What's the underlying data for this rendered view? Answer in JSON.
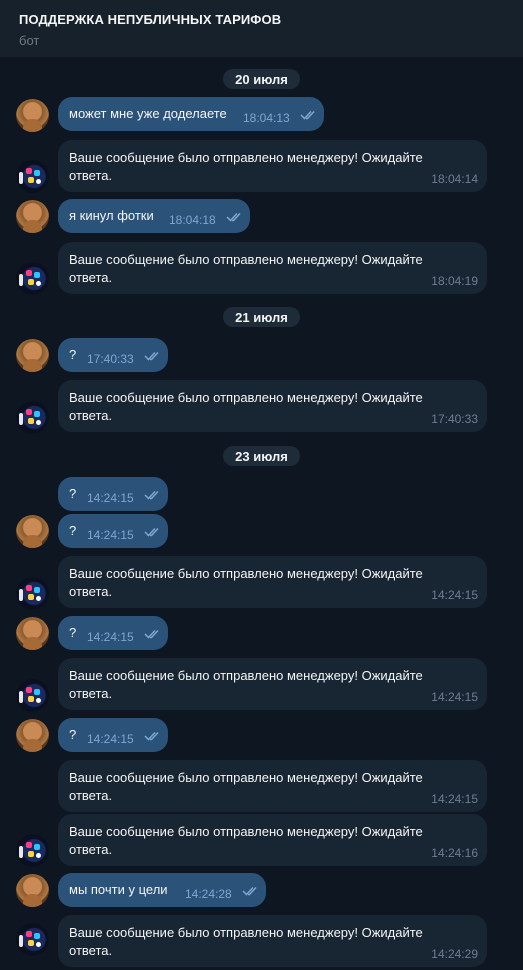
{
  "header": {
    "title": "ПОДДЕРЖКА НЕПУБЛИЧНЫХ ТАРИФОВ",
    "subtitle": "бот"
  },
  "colors": {
    "background": "#0e1621",
    "header_bg": "#17212b",
    "outgoing_bubble": "#2b5278",
    "incoming_bubble": "#182533",
    "date_pill": "#1e2c3a",
    "read_check": "#7da8d3"
  },
  "icons": {
    "read_receipt": "double-check-icon",
    "user_avatar": "user-avatar",
    "bot_avatar": "bot-avatar"
  },
  "dates": {
    "d1": "20 июля",
    "d2": "21 июля",
    "d3": "23 июля"
  },
  "messages": {
    "m1": {
      "text": "может мне уже доделаете",
      "time": "18:04:13"
    },
    "m2": {
      "text": "Ваше сообщение было отправлено менеджеру! Ожидайте ответа.",
      "time": "18:04:14"
    },
    "m3": {
      "text": "я кинул фотки",
      "time": "18:04:18"
    },
    "m4": {
      "text": "Ваше сообщение было отправлено менеджеру! Ожидайте ответа.",
      "time": "18:04:19"
    },
    "m5": {
      "text": "?",
      "time": "17:40:33"
    },
    "m6": {
      "text": "Ваше сообщение было отправлено менеджеру! Ожидайте ответа.",
      "time": "17:40:33"
    },
    "m7": {
      "text": "?",
      "time": "14:24:15"
    },
    "m8": {
      "text": "?",
      "time": "14:24:15"
    },
    "m9": {
      "text": "Ваше сообщение было отправлено менеджеру! Ожидайте ответа.",
      "time": "14:24:15"
    },
    "m10": {
      "text": "?",
      "time": "14:24:15"
    },
    "m11": {
      "text": "Ваше сообщение было отправлено менеджеру! Ожидайте ответа.",
      "time": "14:24:15"
    },
    "m12": {
      "text": "?",
      "time": "14:24:15"
    },
    "m13": {
      "text": "Ваше сообщение было отправлено менеджеру! Ожидайте ответа.",
      "time": "14:24:15"
    },
    "m14": {
      "text": "Ваше сообщение было отправлено менеджеру! Ожидайте ответа.",
      "time": "14:24:16"
    },
    "m15": {
      "text": "мы почти у цели",
      "time": "14:24:28"
    },
    "m16": {
      "text": "Ваше сообщение было отправлено менеджеру! Ожидайте ответа.",
      "time": "14:24:29"
    }
  }
}
